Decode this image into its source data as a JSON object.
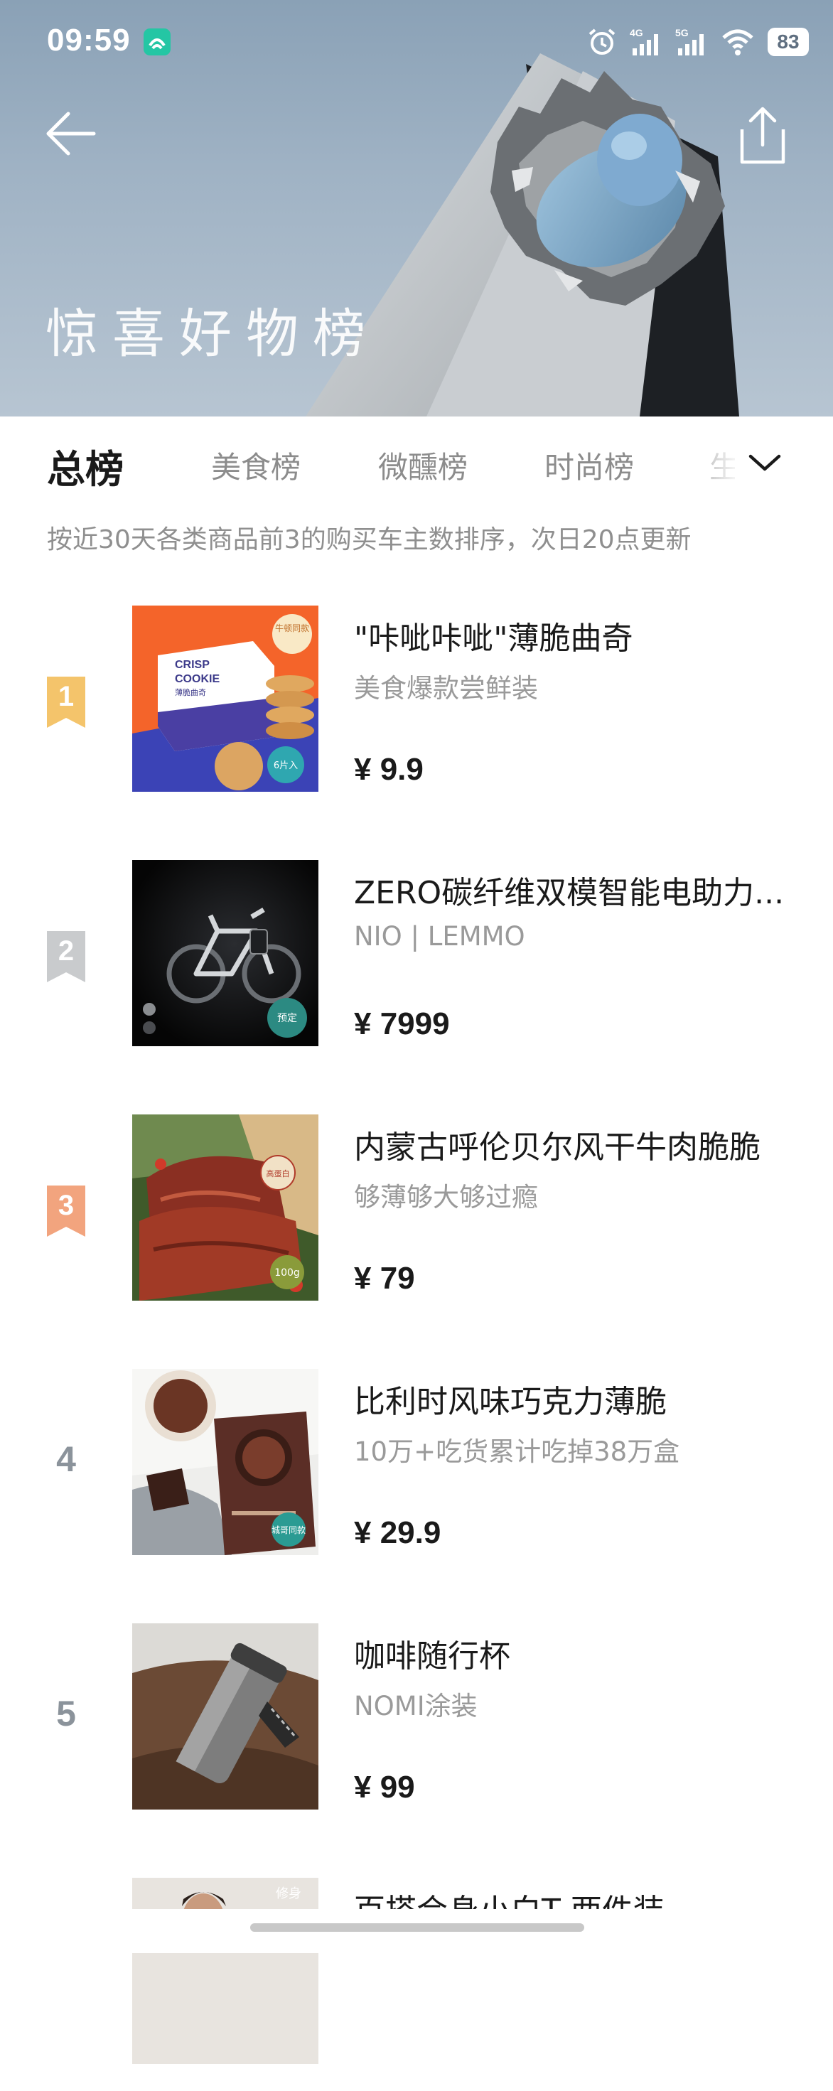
{
  "status_bar": {
    "time": "09:59",
    "battery": "83",
    "icons": [
      "alarm-icon",
      "signal-4g-icon",
      "signal-5g-icon",
      "wifi-icon",
      "battery-icon"
    ]
  },
  "hero": {
    "title": "惊喜好物榜",
    "back_icon": "back-arrow-icon",
    "share_icon": "share-icon"
  },
  "tabs": [
    {
      "label": "总榜",
      "active": true
    },
    {
      "label": "美食榜",
      "active": false
    },
    {
      "label": "微醺榜",
      "active": false
    },
    {
      "label": "时尚榜",
      "active": false
    },
    {
      "label": "生",
      "active": false
    }
  ],
  "subtitle": "按近30天各类商品前3的购买车主数排序，次日20点更新",
  "products": [
    {
      "rank": "1",
      "name": "\"咔呲咔呲\"薄脆曲奇",
      "sub": "美食爆款尝鲜装",
      "price": "¥ 9.9",
      "tags": {
        "corner": "牛顿同款",
        "box_line1": "CRISP",
        "box_line2": "COOKIE",
        "box_line3": "薄脆曲奇",
        "badge": "6片入"
      }
    },
    {
      "rank": "2",
      "name": "ZERO碳纤维双模智能电助力...",
      "sub": "NIO | LEMMO",
      "price": "¥ 7999",
      "tags": {
        "badge": "预定"
      }
    },
    {
      "rank": "3",
      "name": "内蒙古呼伦贝尔风干牛肉脆脆",
      "sub": "够薄够大够过瘾",
      "price": "¥ 79",
      "tags": {
        "badge_top": "高蛋白",
        "badge": "100g"
      }
    },
    {
      "rank": "4",
      "name": "比利时风味巧克力薄脆",
      "sub": "10万+吃货累计吃掉38万盒",
      "price": "¥ 29.9",
      "tags": {
        "badge": "城哥同款"
      }
    },
    {
      "rank": "5",
      "name": "咖啡随行杯",
      "sub": "NOMI涂装",
      "price": "¥ 99",
      "tags": {}
    },
    {
      "rank": "6",
      "name": "百搭合身小白T 两件装",
      "sub": "",
      "price": "",
      "tags": {
        "corner": "修身"
      }
    }
  ]
}
